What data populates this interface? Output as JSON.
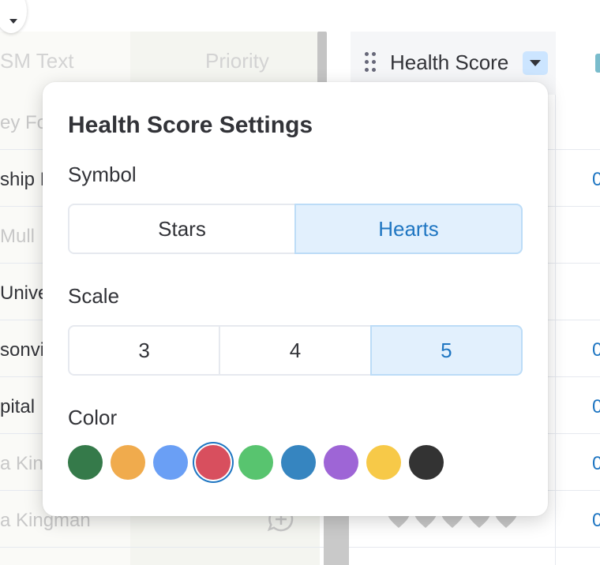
{
  "board": {
    "columns": [
      "SM Text",
      "Priority"
    ],
    "rows": [
      {
        "label": "ey Fo",
        "dim": true
      },
      {
        "label": "ship H",
        "dim": false
      },
      {
        "label": "Mull",
        "dim": true
      },
      {
        "label": "Unive",
        "dim": false
      },
      {
        "label": "sonvil",
        "dim": false
      },
      {
        "label": "pital",
        "dim": false
      },
      {
        "label": "a Kin",
        "dim": true
      },
      {
        "label": "a Kingman",
        "dim": true
      }
    ],
    "right_values": [
      "0",
      "0",
      "0",
      "0",
      "0"
    ],
    "health_column": {
      "title": "Health Score",
      "drag_icon": "drag-handle-icon",
      "dropdown_icon": "chevron-down-icon"
    }
  },
  "popover": {
    "title": "Health Score Settings",
    "symbol": {
      "label": "Symbol",
      "options": [
        "Stars",
        "Hearts"
      ],
      "selected": "Hearts"
    },
    "scale": {
      "label": "Scale",
      "options": [
        "3",
        "4",
        "5"
      ],
      "selected": "5"
    },
    "color": {
      "label": "Color",
      "swatches": [
        "#357a4a",
        "#f0ab4d",
        "#6a9ff5",
        "#d84f5e",
        "#58c46f",
        "#3685c0",
        "#9e65d6",
        "#f7c948",
        "#333333"
      ],
      "selected_index": 3
    }
  },
  "colors": {
    "accent": "#1f76c2",
    "selected_bg": "#e2f0fd"
  }
}
